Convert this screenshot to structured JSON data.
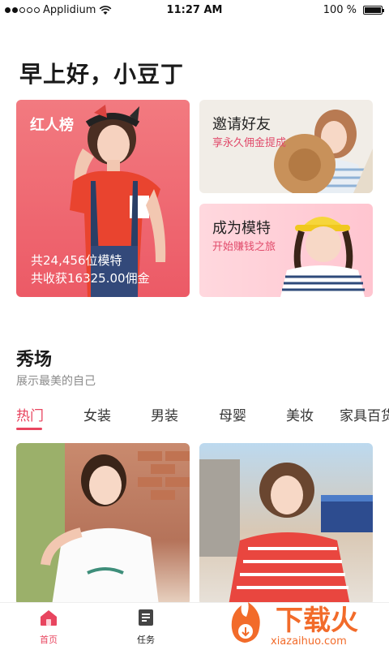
{
  "status_bar": {
    "carrier": "Applidium",
    "time": "11:27 AM",
    "battery": "100 %"
  },
  "greeting": "早上好，小豆丁",
  "cards": {
    "ranking": {
      "title": "红人榜",
      "stat_models": "共24,456位模特",
      "stat_commission": "共收获16325.00佣金"
    },
    "invite": {
      "title": "邀请好友",
      "subtitle": "享永久佣金提成"
    },
    "become_model": {
      "title": "成为模特",
      "subtitle": "开始赚钱之旅"
    }
  },
  "section": {
    "title": "秀场",
    "subtitle": "展示最美的自己"
  },
  "category_tabs": [
    "热门",
    "女装",
    "男装",
    "母婴",
    "美妆",
    "家具百货"
  ],
  "active_tab_index": 0,
  "bottom_nav": [
    {
      "label": "首页",
      "icon": "home-icon",
      "active": true
    },
    {
      "label": "任务",
      "icon": "task-icon",
      "active": false
    }
  ],
  "watermark": {
    "brand": "下载火",
    "url": "xiazaihuo.com"
  },
  "colors": {
    "accent": "#e8455f",
    "card_red": "#ec5a66",
    "card_beige": "#f1ede7",
    "card_pink": "#ffc5d0",
    "watermark_orange": "#f26b2a"
  }
}
